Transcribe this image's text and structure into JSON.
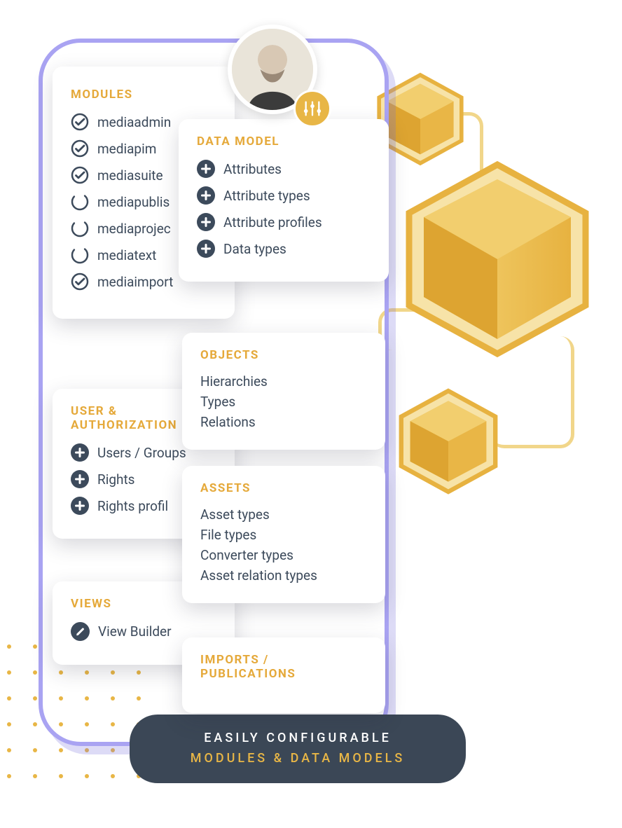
{
  "avatar_badge_icon": "sliders-icon",
  "modules": {
    "title": "MODULES",
    "items": [
      {
        "label": "mediaadmin",
        "checked": true
      },
      {
        "label": "mediapim",
        "checked": true
      },
      {
        "label": "mediasuite",
        "checked": true
      },
      {
        "label": "mediapublis",
        "checked": false
      },
      {
        "label": "mediaprojec",
        "checked": false
      },
      {
        "label": "mediatext",
        "checked": false
      },
      {
        "label": "mediaimport",
        "checked": true
      }
    ]
  },
  "user_auth": {
    "title": "USER & AUTHORIZATION",
    "items": [
      {
        "label": "Users / Groups"
      },
      {
        "label": "Rights"
      },
      {
        "label": "Rights profil"
      }
    ]
  },
  "views": {
    "title": "VIEWS",
    "items": [
      {
        "label": "View Builder"
      }
    ]
  },
  "data_model": {
    "title": "DATA MODEL",
    "items": [
      {
        "label": "Attributes"
      },
      {
        "label": "Attribute types"
      },
      {
        "label": "Attribute profiles"
      },
      {
        "label": "Data types"
      }
    ]
  },
  "objects": {
    "title": "OBJECTS",
    "items": [
      {
        "label": "Hierarchies"
      },
      {
        "label": "Types"
      },
      {
        "label": "Relations"
      }
    ]
  },
  "assets": {
    "title": "ASSETS",
    "items": [
      {
        "label": "Asset types"
      },
      {
        "label": "File types"
      },
      {
        "label": "Converter types"
      },
      {
        "label": "Asset relation types"
      }
    ]
  },
  "imports": {
    "title": "IMPORTS / PUBLICATIONS"
  },
  "banner": {
    "line1": "EASILY CONFIGURABLE",
    "line2": "MODULES & DATA MODELS"
  },
  "colors": {
    "accent": "#E8B646",
    "text": "#3C4A5B",
    "outline": "#A9A3F2"
  }
}
